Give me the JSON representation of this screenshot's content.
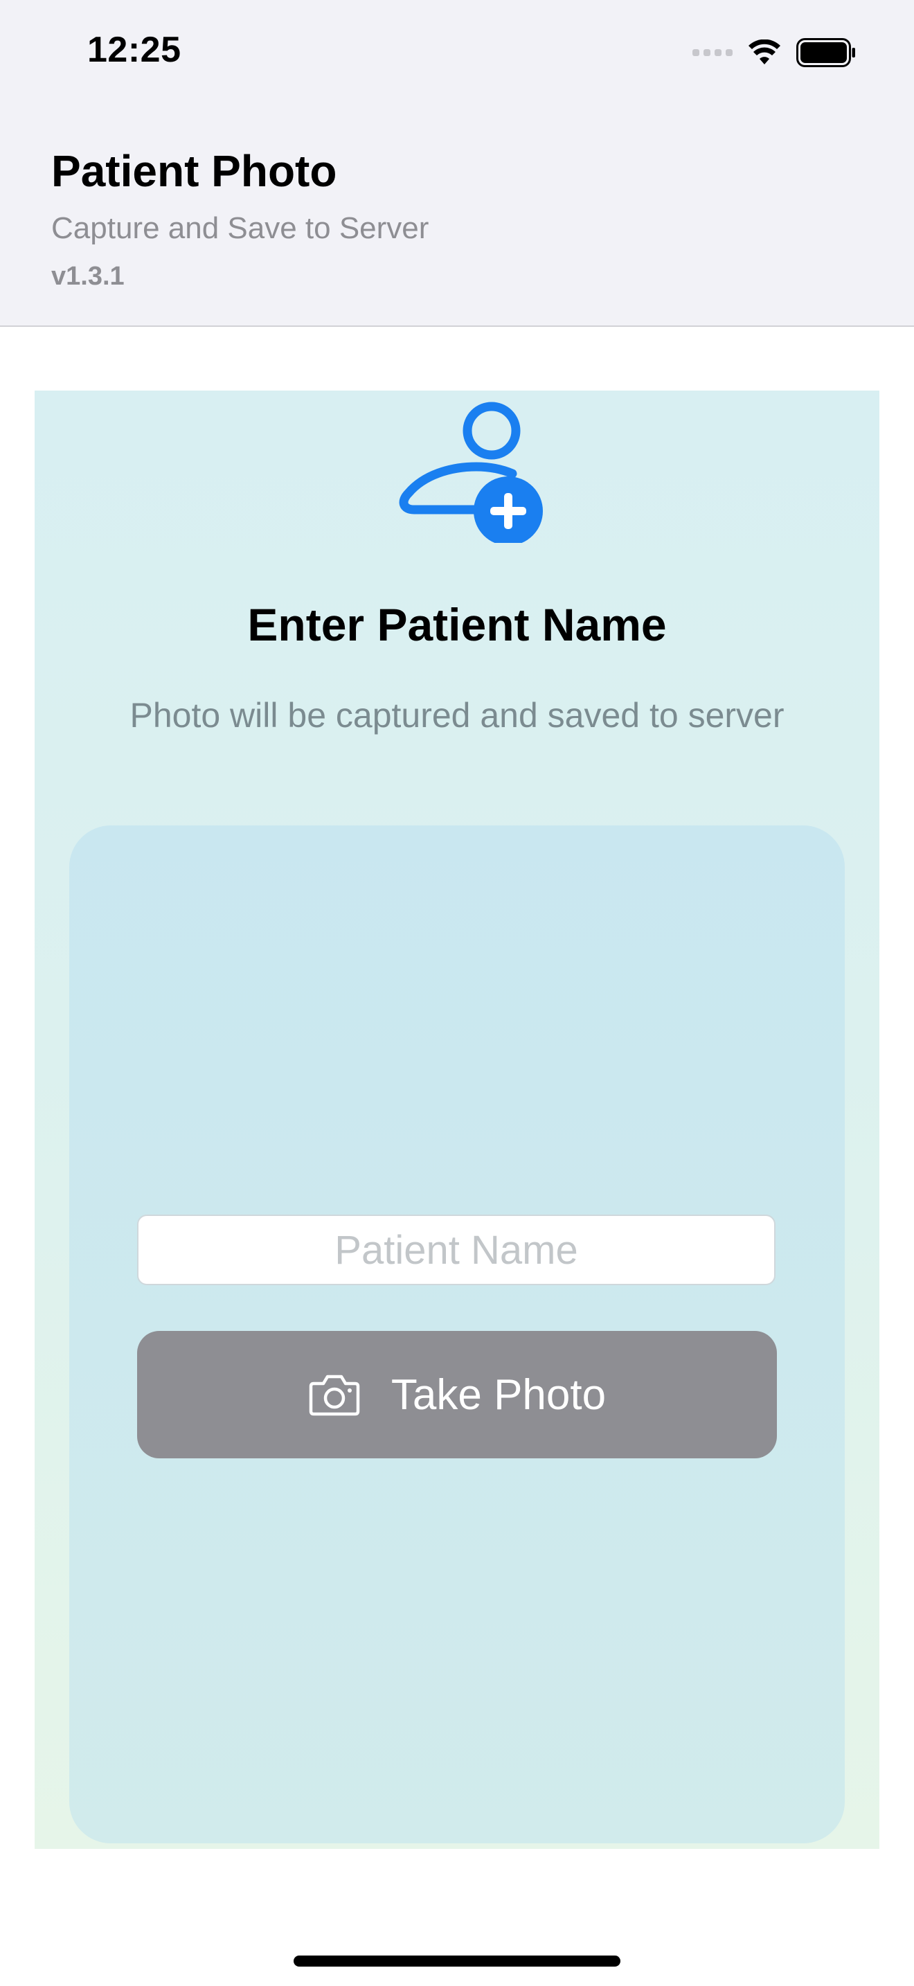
{
  "status_bar": {
    "time": "12:25"
  },
  "header": {
    "title": "Patient Photo",
    "subtitle": "Capture and Save to Server",
    "version": "v1.3.1"
  },
  "form": {
    "heading": "Enter Patient Name",
    "description": "Photo will be captured and saved to server",
    "name_placeholder": "Patient Name",
    "name_value": "",
    "take_photo_label": "Take Photo"
  },
  "icons": {
    "header_icon": "person-add-icon",
    "button_icon": "camera-icon",
    "status": [
      "signal-icon",
      "wifi-icon",
      "battery-icon"
    ]
  },
  "colors": {
    "accent": "#1a7ff0",
    "button_disabled": "#8e8e93",
    "header_bg": "#f2f2f7"
  }
}
